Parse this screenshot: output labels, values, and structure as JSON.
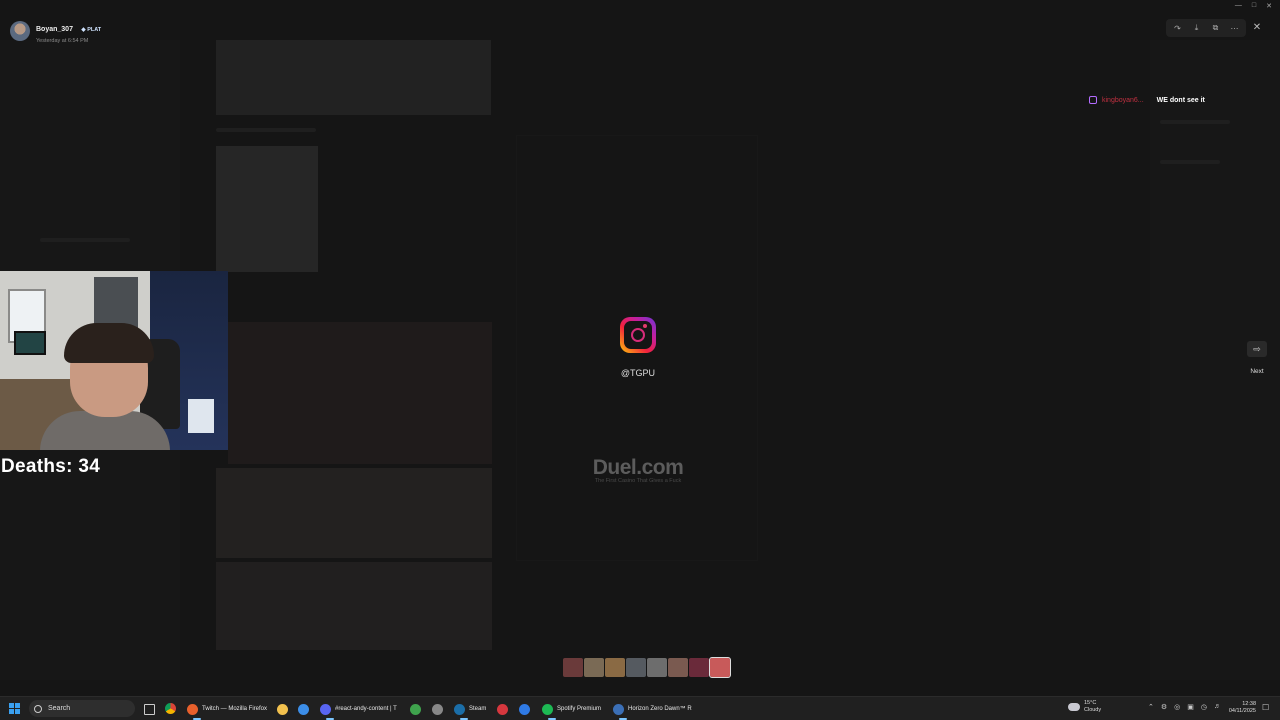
{
  "uploader": {
    "name": "Boyan_307",
    "badge": "PLAT",
    "time": "Yesterday at 6:54 PM"
  },
  "toolbar": {
    "icons": [
      "forward-icon",
      "download-icon",
      "open-external-icon",
      "more-icon"
    ],
    "close_icon": "close-icon"
  },
  "chat": {
    "username": "kingboyan6...",
    "message": "WE dont see it"
  },
  "media": {
    "instagram_handle": "@TGPU",
    "watermark_title": "Duel.com",
    "watermark_subtitle": "The First Casino That Gives a Fuck"
  },
  "navigation": {
    "next_label": "Next"
  },
  "overlay": {
    "deaths_text": "Deaths: 34"
  },
  "filmstrip": {
    "thumbnails": [
      "#6a3a3a",
      "#7a6a55",
      "#8a6a44",
      "#555a60",
      "#6d6d6d",
      "#7a5a50",
      "#6a2a3a",
      "#c85a5a"
    ]
  },
  "taskbar": {
    "search_placeholder": "Search",
    "items": [
      {
        "label": "Twitch — Mozilla Firefox",
        "color": "#e8602c"
      },
      {
        "label": "",
        "color": "#f2c14e"
      },
      {
        "label": "",
        "color": "#3c8ee8"
      },
      {
        "label": "#react-andy-content | T",
        "color": "#5865f2"
      },
      {
        "label": "",
        "color": "#3fa34d"
      },
      {
        "label": "",
        "color": "#888888"
      },
      {
        "label": "Steam",
        "color": "#1b6ea8"
      },
      {
        "label": "",
        "color": "#d6373e"
      },
      {
        "label": "",
        "color": "#2f7ae5"
      },
      {
        "label": "Spotify Premium",
        "color": "#1db954"
      },
      {
        "label": "Horizon Zero Dawn™ R",
        "color": "#3b6fb6"
      }
    ],
    "weather": {
      "temp": "15°C",
      "condition": "Cloudy"
    },
    "clock": {
      "time": "12:38",
      "date": "04/11/2025"
    }
  }
}
